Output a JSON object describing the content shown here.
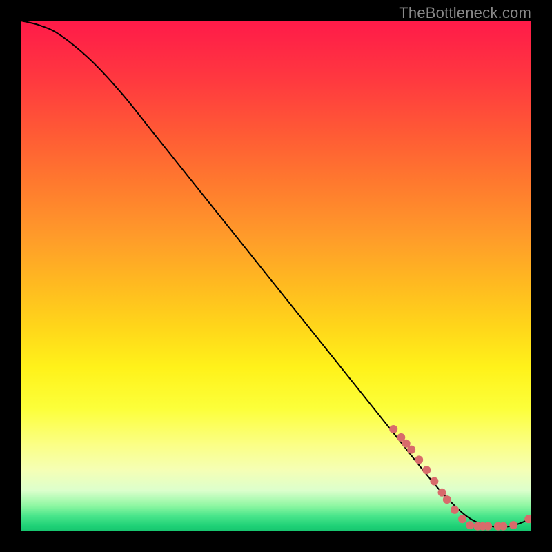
{
  "watermark": "TheBottleneck.com",
  "colors": {
    "curve": "#000000",
    "dot_fill": "#d86b6b",
    "dot_stroke": "#b84c4c"
  },
  "chart_data": {
    "type": "line",
    "title": "",
    "xlabel": "",
    "ylabel": "",
    "xlim": [
      0,
      100
    ],
    "ylim": [
      0,
      100
    ],
    "grid": false,
    "legend": false,
    "series": [
      {
        "name": "curve",
        "x": [
          0,
          4,
          8,
          14,
          20,
          26,
          32,
          38,
          44,
          50,
          56,
          62,
          68,
          74,
          80,
          84,
          88,
          92,
          96,
          100
        ],
        "y": [
          100,
          99,
          97,
          92,
          85.5,
          78,
          70.5,
          63,
          55.5,
          48,
          40.5,
          33,
          25.5,
          18,
          10.5,
          6,
          2.5,
          1,
          1,
          2.5
        ]
      }
    ],
    "dots": [
      {
        "x": 73,
        "y": 20
      },
      {
        "x": 74.5,
        "y": 18.4
      },
      {
        "x": 75.5,
        "y": 17.2
      },
      {
        "x": 76.5,
        "y": 16
      },
      {
        "x": 78,
        "y": 14
      },
      {
        "x": 79.5,
        "y": 12
      },
      {
        "x": 81,
        "y": 9.8
      },
      {
        "x": 82.5,
        "y": 7.6
      },
      {
        "x": 83.5,
        "y": 6.2
      },
      {
        "x": 85,
        "y": 4.2
      },
      {
        "x": 86.5,
        "y": 2.4
      },
      {
        "x": 88,
        "y": 1.2
      },
      {
        "x": 89.5,
        "y": 1
      },
      {
        "x": 90.5,
        "y": 1
      },
      {
        "x": 91.5,
        "y": 1
      },
      {
        "x": 93.5,
        "y": 1
      },
      {
        "x": 94.5,
        "y": 1
      },
      {
        "x": 96.5,
        "y": 1.2
      },
      {
        "x": 99.5,
        "y": 2.4
      }
    ],
    "dot_radius_px": 6
  }
}
